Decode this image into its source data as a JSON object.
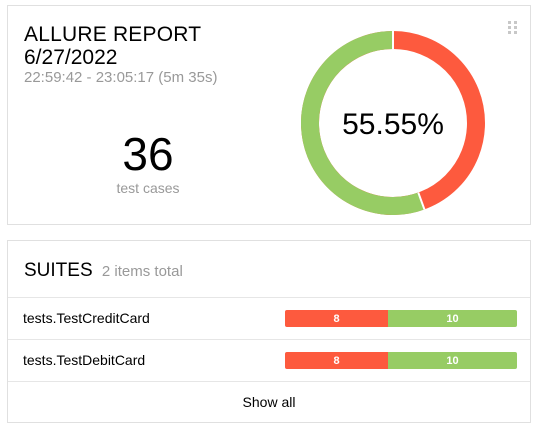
{
  "summary": {
    "title": "ALLURE REPORT",
    "date": "6/27/2022",
    "time_range": "22:59:42 - 23:05:17 (5m 35s)",
    "test_case_count": "36",
    "test_case_label": "test cases",
    "percentage_text": "55.55%",
    "passed_fraction": 0.5555,
    "colors": {
      "failed": "#fd5a3e",
      "passed": "#97cc64"
    }
  },
  "suites": {
    "title": "SUITES",
    "count_text": "2 items total",
    "items": [
      {
        "name": "tests.TestCreditCard",
        "failed": "8",
        "passed": "10"
      },
      {
        "name": "tests.TestDebitCard",
        "failed": "8",
        "passed": "10"
      }
    ],
    "show_all_label": "Show all"
  },
  "icons": {
    "drag_handle": "drag-handle-icon"
  }
}
